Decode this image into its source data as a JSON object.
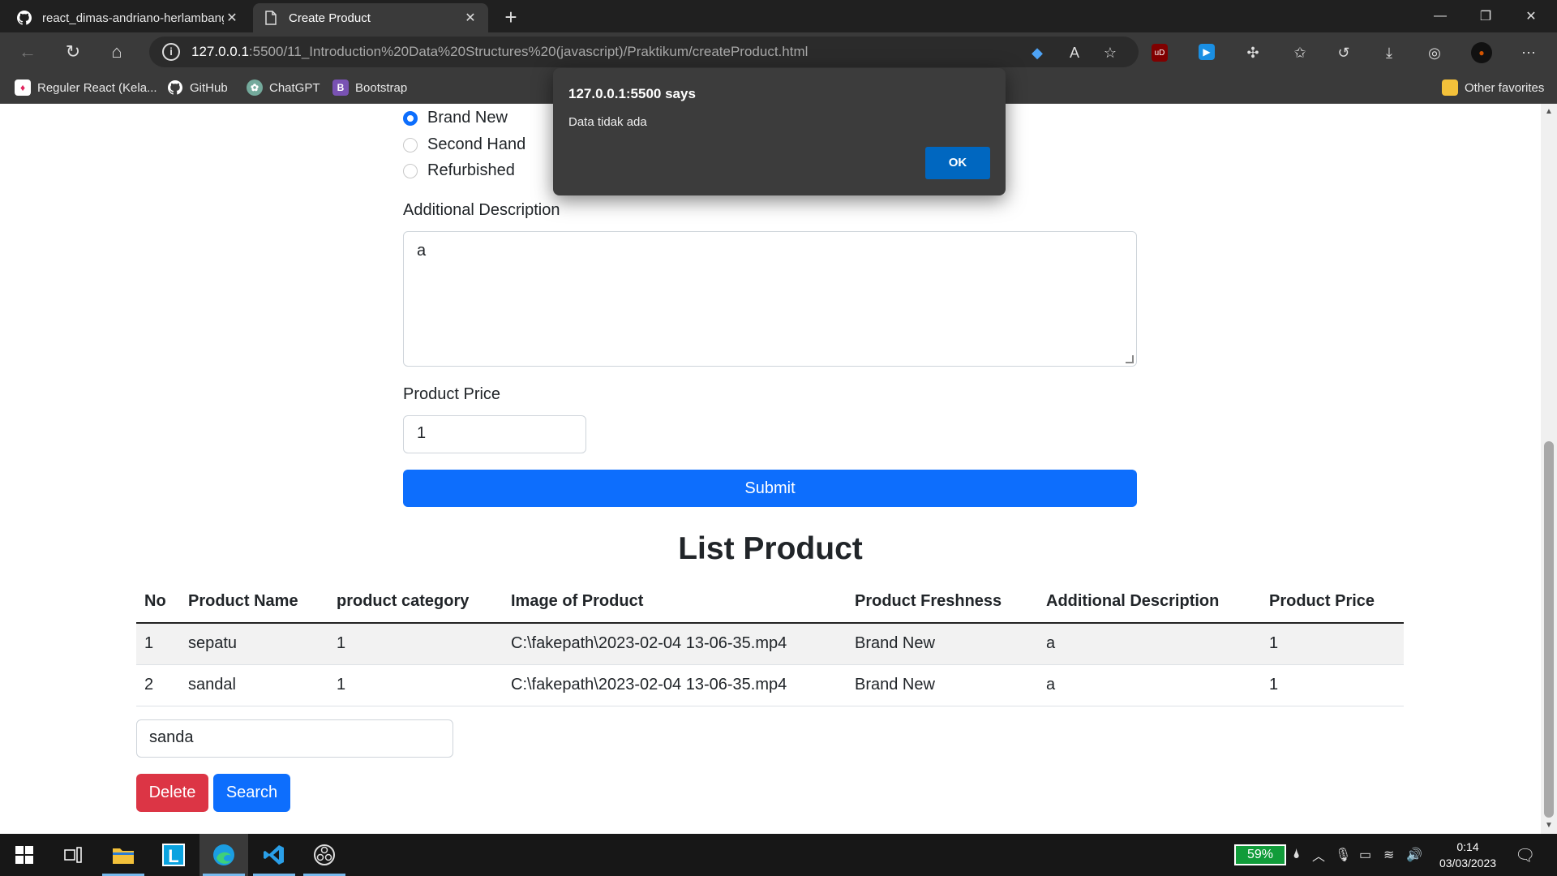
{
  "browser": {
    "tabs": [
      {
        "title": "react_dimas-andriano-herlambang",
        "active": false,
        "icon": "github-icon"
      },
      {
        "title": "Create Product",
        "active": true,
        "icon": "page-icon"
      }
    ],
    "address": {
      "host": "127.0.0.1",
      "path": ":5500/11_Introduction%20Data%20Structures%20(javascript)/Praktikum/createProduct.html"
    },
    "bookmarks": [
      {
        "label": "Reguler React (Kela...",
        "icon": "react-bookmark-icon",
        "color": "#e0245e"
      },
      {
        "label": "GitHub",
        "icon": "github-icon",
        "color": "#ffffff"
      },
      {
        "label": "ChatGPT",
        "icon": "chatgpt-icon",
        "color": "#74aa9c"
      },
      {
        "label": "Bootstrap",
        "icon": "bootstrap-icon",
        "color": "#7952b3"
      }
    ],
    "other_favorites": "Other favorites"
  },
  "form": {
    "freshness_options": [
      {
        "label": "Brand New",
        "checked": true
      },
      {
        "label": "Second Hand",
        "checked": false
      },
      {
        "label": "Refurbished",
        "checked": false
      }
    ],
    "description_label": "Additional Description",
    "description_value": "a",
    "price_label": "Product Price",
    "price_value": "1",
    "submit_label": "Submit"
  },
  "list": {
    "title": "List Product",
    "headers": [
      "No",
      "Product Name",
      "product category",
      "Image of Product",
      "Product Freshness",
      "Additional Description",
      "Product Price"
    ],
    "rows": [
      [
        "1",
        "sepatu",
        "1",
        "C:\\fakepath\\2023-02-04 13-06-35.mp4",
        "Brand New",
        "a",
        "1"
      ],
      [
        "2",
        "sandal",
        "1",
        "C:\\fakepath\\2023-02-04 13-06-35.mp4",
        "Brand New",
        "a",
        "1"
      ]
    ],
    "search_value": "sanda",
    "delete_label": "Delete",
    "search_label": "Search"
  },
  "dialog": {
    "title": "127.0.0.1:5500 says",
    "message": "Data tidak ada",
    "ok_label": "OK"
  },
  "taskbar": {
    "battery": "59%",
    "time": "0:14",
    "date": "03/03/2023"
  },
  "colors": {
    "primary": "#0d6efd",
    "danger": "#dc3545",
    "dialog_ok": "#0067c0"
  }
}
